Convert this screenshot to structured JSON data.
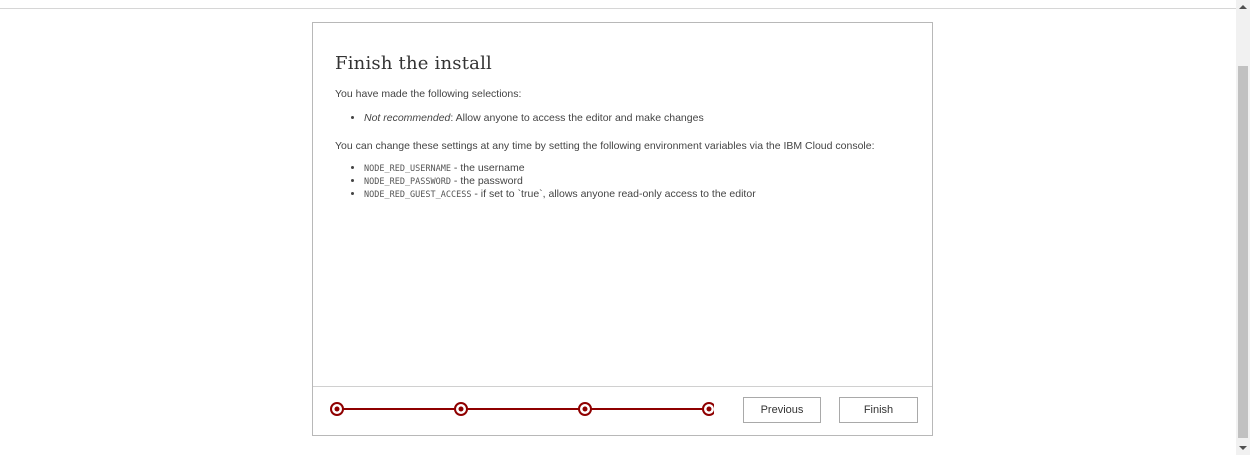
{
  "dialog": {
    "title": "Finish the install",
    "intro": "You have made the following selections:",
    "selection": {
      "emphasis": "Not recommended",
      "text": ": Allow anyone to access the editor and make changes"
    },
    "change_note": "You can change these settings at any time by setting the following environment variables via the IBM Cloud console:",
    "env_vars": [
      {
        "name": "NODE_RED_USERNAME",
        "desc": " - the username"
      },
      {
        "name": "NODE_RED_PASSWORD",
        "desc": " - the password"
      },
      {
        "name": "NODE_RED_GUEST_ACCESS",
        "desc": " - if set to `true`, allows anyone read-only access to the editor"
      }
    ]
  },
  "footer": {
    "steps_total": 4,
    "steps_completed": 4,
    "accent_color": "#8f0000",
    "previous_label": "Previous",
    "finish_label": "Finish"
  }
}
